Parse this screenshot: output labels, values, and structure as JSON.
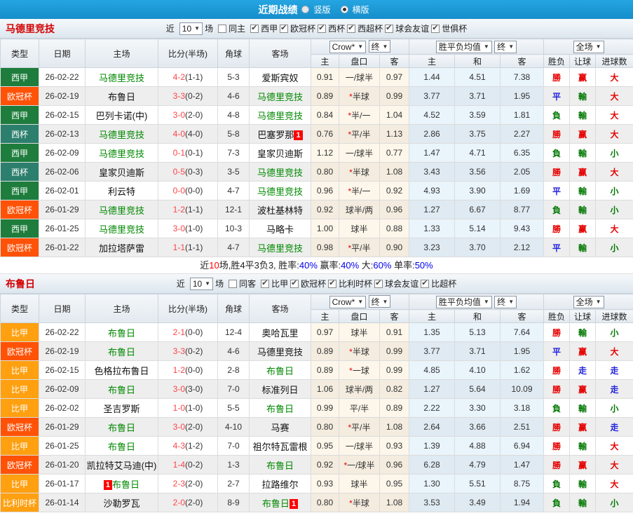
{
  "topbar": {
    "title": "近期战绩",
    "radio_vertical": "竖版",
    "radio_horizontal": "横版",
    "selected": "横版"
  },
  "colors": {
    "topbar_blue": "#1b9ad8",
    "team_green": "#008800",
    "score_red": "#ff4348",
    "badge_red": "#fe0000",
    "type_colors": {
      "西甲": "#1e7d3c",
      "欧冠杯": "#ff5206",
      "西杯": "#2c7f6d",
      "比甲": "#ffa011",
      "比利时杯": "#ffa011"
    },
    "result_colors": {
      "勝": "#e60000",
      "平": "#2222dd",
      "負": "#007700",
      "赢": "#e60000",
      "輸": "#007700",
      "走": "#2222dd",
      "大": "#e60000",
      "小": "#007700"
    }
  },
  "table_header": {
    "cols": [
      "类型",
      "日期",
      "主场",
      "比分(半场)",
      "角球",
      "客场"
    ],
    "sub_cols": [
      "主",
      "盘口",
      "客",
      "主",
      "和",
      "客",
      "胜负",
      "让球",
      "进球数"
    ],
    "odds_select": "Crow*",
    "odds_final_select": "终",
    "euro_select": "胜平负均值",
    "euro_final_select": "终",
    "scope_select": "全场"
  },
  "sections": [
    {
      "team": "马德里竞技",
      "filter": {
        "near_label": "近",
        "matches_value": "10",
        "matches_label": "场",
        "same_label": "同主",
        "same_checked": false,
        "leagues": [
          "西甲",
          "欧冠杯",
          "西杯",
          "西超杯",
          "球会友谊",
          "世俱杯"
        ]
      },
      "rows": [
        {
          "type": "西甲",
          "date": "26-02-22",
          "home": "马德里竞技",
          "home_self": true,
          "home_badge": "",
          "score": "4-2",
          "half": "(1-1)",
          "corners": "5-3",
          "away": "爱斯宾奴",
          "away_self": false,
          "away_badge": "",
          "o1": "0.91",
          "star": false,
          "hc": "一/球半",
          "o2": "0.97",
          "e1": "1.44",
          "e2": "4.51",
          "e3": "7.38",
          "r": "勝",
          "rl": "赢",
          "g": "大"
        },
        {
          "type": "欧冠杯",
          "date": "26-02-19",
          "home": "布鲁日",
          "home_self": false,
          "home_badge": "",
          "score": "3-3",
          "half": "(0-2)",
          "corners": "4-6",
          "away": "马德里竞技",
          "away_self": true,
          "away_badge": "",
          "o1": "0.89",
          "star": true,
          "hc": "半球",
          "o2": "0.99",
          "e1": "3.77",
          "e2": "3.71",
          "e3": "1.95",
          "r": "平",
          "rl": "輸",
          "g": "大"
        },
        {
          "type": "西甲",
          "date": "26-02-15",
          "home": "巴列卡诺(中)",
          "home_self": false,
          "home_badge": "",
          "score": "3-0",
          "half": "(2-0)",
          "corners": "4-8",
          "away": "马德里竞技",
          "away_self": true,
          "away_badge": "",
          "o1": "0.84",
          "star": true,
          "hc": "半/一",
          "o2": "1.04",
          "e1": "4.52",
          "e2": "3.59",
          "e3": "1.81",
          "r": "負",
          "rl": "輸",
          "g": "大"
        },
        {
          "type": "西杯",
          "date": "26-02-13",
          "home": "马德里竞技",
          "home_self": true,
          "home_badge": "",
          "score": "4-0",
          "half": "(4-0)",
          "corners": "5-8",
          "away": "巴塞罗那",
          "away_self": false,
          "away_badge": "1",
          "o1": "0.76",
          "star": true,
          "hc": "平/半",
          "o2": "1.13",
          "e1": "2.86",
          "e2": "3.75",
          "e3": "2.27",
          "r": "勝",
          "rl": "赢",
          "g": "大"
        },
        {
          "type": "西甲",
          "date": "26-02-09",
          "home": "马德里竞技",
          "home_self": true,
          "home_badge": "",
          "score": "0-1",
          "half": "(0-1)",
          "corners": "7-3",
          "away": "皇家贝迪斯",
          "away_self": false,
          "away_badge": "",
          "o1": "1.12",
          "star": false,
          "hc": "一/球半",
          "o2": "0.77",
          "e1": "1.47",
          "e2": "4.71",
          "e3": "6.35",
          "r": "負",
          "rl": "輸",
          "g": "小"
        },
        {
          "type": "西杯",
          "date": "26-02-06",
          "home": "皇家贝迪斯",
          "home_self": false,
          "home_badge": "",
          "score": "0-5",
          "half": "(0-3)",
          "corners": "3-5",
          "away": "马德里竞技",
          "away_self": true,
          "away_badge": "",
          "o1": "0.80",
          "star": true,
          "hc": "半球",
          "o2": "1.08",
          "e1": "3.43",
          "e2": "3.56",
          "e3": "2.05",
          "r": "勝",
          "rl": "赢",
          "g": "大"
        },
        {
          "type": "西甲",
          "date": "26-02-01",
          "home": "利云特",
          "home_self": false,
          "home_badge": "",
          "score": "0-0",
          "half": "(0-0)",
          "corners": "4-7",
          "away": "马德里竞技",
          "away_self": true,
          "away_badge": "",
          "o1": "0.96",
          "star": true,
          "hc": "半/一",
          "o2": "0.92",
          "e1": "4.93",
          "e2": "3.90",
          "e3": "1.69",
          "r": "平",
          "rl": "輸",
          "g": "小"
        },
        {
          "type": "欧冠杯",
          "date": "26-01-29",
          "home": "马德里竞技",
          "home_self": true,
          "home_badge": "",
          "score": "1-2",
          "half": "(1-1)",
          "corners": "12-1",
          "away": "波杜基林特",
          "away_self": false,
          "away_badge": "",
          "o1": "0.92",
          "star": false,
          "hc": "球半/两",
          "o2": "0.96",
          "e1": "1.27",
          "e2": "6.67",
          "e3": "8.77",
          "r": "負",
          "rl": "輸",
          "g": "小"
        },
        {
          "type": "西甲",
          "date": "26-01-25",
          "home": "马德里竞技",
          "home_self": true,
          "home_badge": "",
          "score": "3-0",
          "half": "(1-0)",
          "corners": "10-3",
          "away": "马略卡",
          "away_self": false,
          "away_badge": "",
          "o1": "1.00",
          "star": false,
          "hc": "球半",
          "o2": "0.88",
          "e1": "1.33",
          "e2": "5.14",
          "e3": "9.43",
          "r": "勝",
          "rl": "赢",
          "g": "大"
        },
        {
          "type": "欧冠杯",
          "date": "26-01-22",
          "home": "加拉塔萨雷",
          "home_self": false,
          "home_badge": "",
          "score": "1-1",
          "half": "(1-1)",
          "corners": "4-7",
          "away": "马德里竞技",
          "away_self": true,
          "away_badge": "",
          "o1": "0.98",
          "star": true,
          "hc": "平/半",
          "o2": "0.90",
          "e1": "3.23",
          "e2": "3.70",
          "e3": "2.12",
          "r": "平",
          "rl": "輸",
          "g": "小"
        }
      ],
      "summary_parts": [
        {
          "t": "近",
          "c": ""
        },
        {
          "t": "10",
          "c": "red"
        },
        {
          "t": "场,胜4平3负3, 胜率:",
          "c": ""
        },
        {
          "t": "40%",
          "c": "blue"
        },
        {
          "t": " 赢率:",
          "c": ""
        },
        {
          "t": "40%",
          "c": "blue"
        },
        {
          "t": " 大:",
          "c": ""
        },
        {
          "t": "60%",
          "c": "blue"
        },
        {
          "t": " 单率:",
          "c": ""
        },
        {
          "t": "50%",
          "c": "blue"
        }
      ]
    },
    {
      "team": "布鲁日",
      "filter": {
        "near_label": "近",
        "matches_value": "10",
        "matches_label": "场",
        "same_label": "同客",
        "same_checked": false,
        "leagues": [
          "比甲",
          "欧冠杯",
          "比利时杯",
          "球会友谊",
          "比超杯"
        ]
      },
      "rows": [
        {
          "type": "比甲",
          "date": "26-02-22",
          "home": "布鲁日",
          "home_self": true,
          "home_badge": "",
          "score": "2-1",
          "half": "(0-0)",
          "corners": "12-4",
          "away": "奥哈瓦里",
          "away_self": false,
          "away_badge": "",
          "o1": "0.97",
          "star": false,
          "hc": "球半",
          "o2": "0.91",
          "e1": "1.35",
          "e2": "5.13",
          "e3": "7.64",
          "r": "勝",
          "rl": "輸",
          "g": "小"
        },
        {
          "type": "欧冠杯",
          "date": "26-02-19",
          "home": "布鲁日",
          "home_self": true,
          "home_badge": "",
          "score": "3-3",
          "half": "(0-2)",
          "corners": "4-6",
          "away": "马德里竞技",
          "away_self": false,
          "away_badge": "",
          "o1": "0.89",
          "star": true,
          "hc": "半球",
          "o2": "0.99",
          "e1": "3.77",
          "e2": "3.71",
          "e3": "1.95",
          "r": "平",
          "rl": "赢",
          "g": "大"
        },
        {
          "type": "比甲",
          "date": "26-02-15",
          "home": "色格拉布鲁日",
          "home_self": false,
          "home_badge": "",
          "score": "1-2",
          "half": "(0-0)",
          "corners": "2-8",
          "away": "布鲁日",
          "away_self": true,
          "away_badge": "",
          "o1": "0.89",
          "star": true,
          "hc": "一球",
          "o2": "0.99",
          "e1": "4.85",
          "e2": "4.10",
          "e3": "1.62",
          "r": "勝",
          "rl": "走",
          "g": "走"
        },
        {
          "type": "比甲",
          "date": "26-02-09",
          "home": "布鲁日",
          "home_self": true,
          "home_badge": "",
          "score": "3-0",
          "half": "(3-0)",
          "corners": "7-0",
          "away": "标准列日",
          "away_self": false,
          "away_badge": "",
          "o1": "1.06",
          "star": false,
          "hc": "球半/两",
          "o2": "0.82",
          "e1": "1.27",
          "e2": "5.64",
          "e3": "10.09",
          "r": "勝",
          "rl": "赢",
          "g": "走"
        },
        {
          "type": "比甲",
          "date": "26-02-02",
          "home": "圣吉罗斯",
          "home_self": false,
          "home_badge": "",
          "score": "1-0",
          "half": "(1-0)",
          "corners": "5-5",
          "away": "布鲁日",
          "away_self": true,
          "away_badge": "",
          "o1": "0.99",
          "star": false,
          "hc": "平/半",
          "o2": "0.89",
          "e1": "2.22",
          "e2": "3.30",
          "e3": "3.18",
          "r": "負",
          "rl": "輸",
          "g": "小"
        },
        {
          "type": "欧冠杯",
          "date": "26-01-29",
          "home": "布鲁日",
          "home_self": true,
          "home_badge": "",
          "score": "3-0",
          "half": "(2-0)",
          "corners": "4-10",
          "away": "马赛",
          "away_self": false,
          "away_badge": "",
          "o1": "0.80",
          "star": true,
          "hc": "平/半",
          "o2": "1.08",
          "e1": "2.64",
          "e2": "3.66",
          "e3": "2.51",
          "r": "勝",
          "rl": "赢",
          "g": "走"
        },
        {
          "type": "比甲",
          "date": "26-01-25",
          "home": "布鲁日",
          "home_self": true,
          "home_badge": "",
          "score": "4-3",
          "half": "(1-2)",
          "corners": "7-0",
          "away": "祖尔特瓦雷根",
          "away_self": false,
          "away_badge": "",
          "o1": "0.95",
          "star": false,
          "hc": "一/球半",
          "o2": "0.93",
          "e1": "1.39",
          "e2": "4.88",
          "e3": "6.94",
          "r": "勝",
          "rl": "輸",
          "g": "大"
        },
        {
          "type": "欧冠杯",
          "date": "26-01-20",
          "home": "凯拉特艾马迪(中)",
          "home_self": false,
          "home_badge": "",
          "score": "1-4",
          "half": "(0-2)",
          "corners": "1-3",
          "away": "布鲁日",
          "away_self": true,
          "away_badge": "",
          "o1": "0.92",
          "star": true,
          "hc": "一/球半",
          "o2": "0.96",
          "e1": "6.28",
          "e2": "4.79",
          "e3": "1.47",
          "r": "勝",
          "rl": "赢",
          "g": "大"
        },
        {
          "type": "比甲",
          "date": "26-01-17",
          "home": "布鲁日",
          "home_self": true,
          "home_badge": "1",
          "score": "2-3",
          "half": "(2-0)",
          "corners": "2-7",
          "away": "拉路维尔",
          "away_self": false,
          "away_badge": "",
          "o1": "0.93",
          "star": false,
          "hc": "球半",
          "o2": "0.95",
          "e1": "1.30",
          "e2": "5.51",
          "e3": "8.75",
          "r": "負",
          "rl": "輸",
          "g": "大"
        },
        {
          "type": "比利时杯",
          "date": "26-01-14",
          "home": "沙勒罗瓦",
          "home_self": false,
          "home_badge": "",
          "score": "2-0",
          "half": "(2-0)",
          "corners": "8-9",
          "away": "布鲁日",
          "away_self": true,
          "away_badge": "1",
          "o1": "0.80",
          "star": true,
          "hc": "半球",
          "o2": "1.08",
          "e1": "3.53",
          "e2": "3.49",
          "e3": "1.94",
          "r": "負",
          "rl": "輸",
          "g": "小"
        }
      ],
      "summary_parts": []
    }
  ]
}
